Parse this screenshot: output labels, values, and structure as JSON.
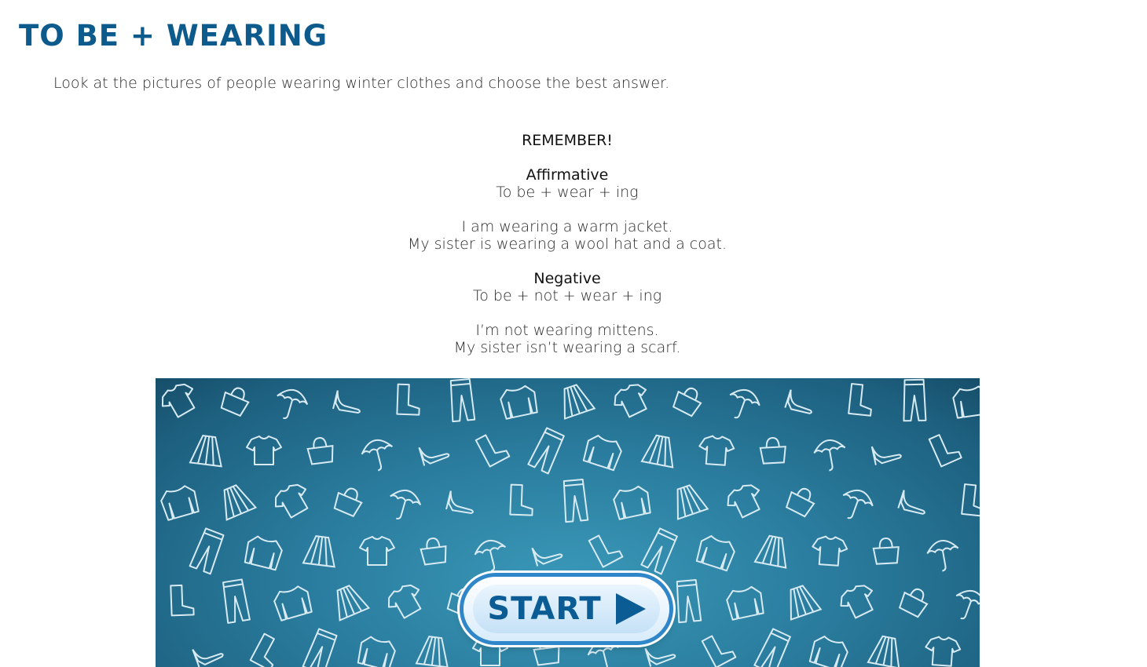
{
  "title": "TO BE + WEARING",
  "instructions": "Look at the pictures of people wearing winter clothes and choose the best answer.",
  "remember": {
    "heading": "REMEMBER!",
    "affirmative": {
      "heading": "Affirmative",
      "rule": "To be + wear + ing",
      "examples": [
        "I am wearing a warm jacket.",
        "My sister is wearing a wool hat and a coat."
      ]
    },
    "negative": {
      "heading": "Negative",
      "rule": "To be + not + wear + ing",
      "examples": [
        "I’m not wearing mittens.",
        "My sister isn’t wearing a scarf."
      ]
    }
  },
  "banner": {
    "start_label": "START",
    "icons": [
      "shirt-icon",
      "jeans-icon",
      "umbrella-icon",
      "skirt-icon",
      "boot-icon",
      "bag-icon",
      "sweater-icon",
      "heel-icon"
    ],
    "colors": {
      "banner": "#2a7c9e",
      "button_ring": "#2f86c9",
      "button_text": "#0b5b94"
    }
  }
}
